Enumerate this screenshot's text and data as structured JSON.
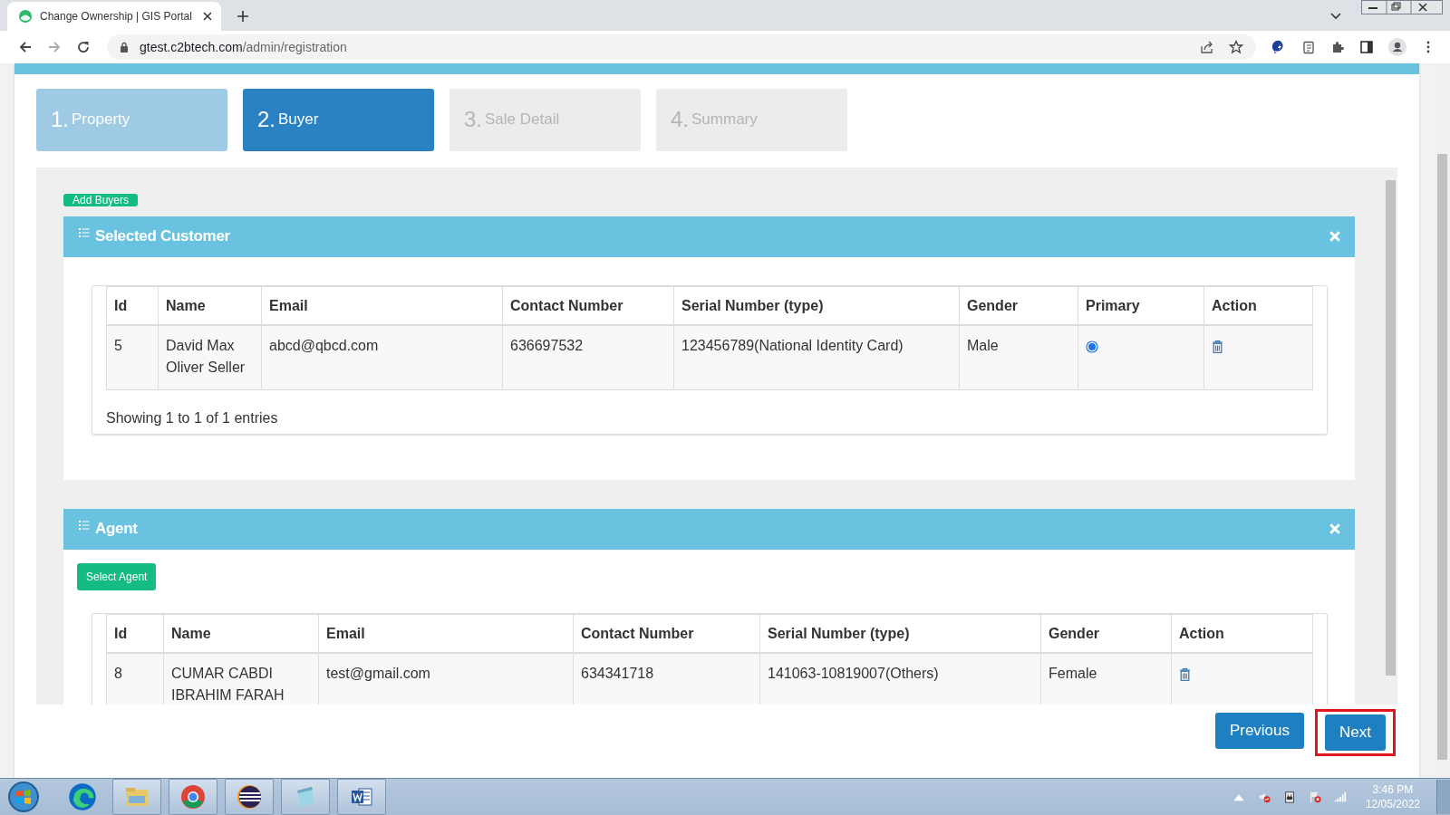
{
  "browser": {
    "tab_title": "Change Ownership | GIS Portal",
    "url_host": "gtest.c2btech.com",
    "url_path": "/admin/registration"
  },
  "steps": [
    {
      "number": "1.",
      "label": "Property",
      "selected": false,
      "completed": true
    },
    {
      "number": "2.",
      "label": "Buyer",
      "selected": true,
      "completed": false
    },
    {
      "number": "3.",
      "label": "Sale Detail",
      "selected": false,
      "completed": false
    },
    {
      "number": "4.",
      "label": "Summary",
      "selected": false,
      "completed": false
    }
  ],
  "add_button": "Add Buyers",
  "customer_card": {
    "title": "Selected Customer",
    "columns": [
      {
        "label": "Id",
        "kind": "text"
      },
      {
        "label": "Name",
        "kind": "text"
      },
      {
        "label": "Email",
        "kind": "text"
      },
      {
        "label": "Contact Number",
        "kind": "text"
      },
      {
        "label": "Serial Number (type)",
        "kind": "text"
      },
      {
        "label": "Gender",
        "kind": "text"
      },
      {
        "label": "Primary",
        "kind": "radio"
      },
      {
        "label": "Action",
        "kind": "action"
      }
    ],
    "rows": [
      {
        "cells": [
          "5",
          "David Max Oliver Seller",
          "abcd@qbcd.com",
          "636697532",
          "123456789(National Identity Card)",
          "Male"
        ],
        "selected": true
      }
    ],
    "footer": "Showing 1 to 1 of 1 entries"
  },
  "agent_card": {
    "title": "Agent",
    "select_button": "Select Agent",
    "columns": [
      {
        "label": "Id",
        "kind": "text"
      },
      {
        "label": "Name",
        "kind": "text"
      },
      {
        "label": "Email",
        "kind": "text"
      },
      {
        "label": "Contact Number",
        "kind": "text"
      },
      {
        "label": "Serial Number (type)",
        "kind": "text"
      },
      {
        "label": "Gender",
        "kind": "text"
      },
      {
        "label": "Action",
        "kind": "action"
      }
    ],
    "rows": [
      {
        "cells": [
          "8",
          "CUMAR CABDI IBRAHIM FARAH",
          "test@gmail.com",
          "634341718",
          "141063-10819007(Others)",
          "Female"
        ]
      }
    ]
  },
  "nav_buttons": [
    {
      "label": "Previous",
      "highlighted": false
    },
    {
      "label": "Next",
      "highlighted": true
    }
  ],
  "clock": {
    "time": "3:46 PM",
    "date": "12/05/2022"
  }
}
